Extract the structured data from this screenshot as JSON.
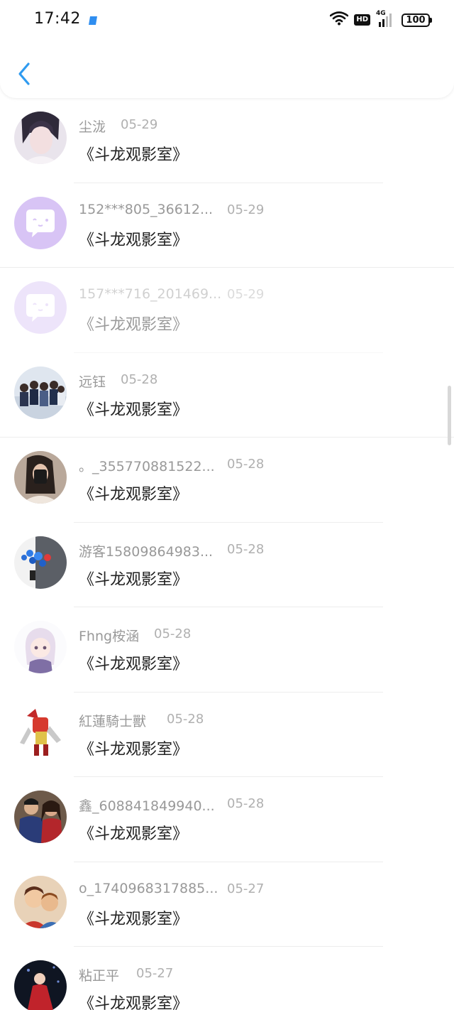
{
  "status_bar": {
    "time": "17:42",
    "hd": "HD",
    "network": "4G",
    "battery": "100"
  },
  "header": {
    "back_icon": "chevron-left-icon",
    "accent_color": "#2f9bf0"
  },
  "items": [
    {
      "username": "尘泷",
      "date": "05-29",
      "comment": "《斗龙观影室》",
      "avatar": "anime-portrait"
    },
    {
      "username": "152***805_36612...",
      "date": "05-29",
      "comment": "《斗龙观影室》",
      "avatar": "default-chat"
    },
    {
      "username": "157***716_201469...",
      "date": "05-29",
      "comment": "《斗龙观影室》",
      "avatar": "default-chat"
    },
    {
      "username": "远钰",
      "date": "05-28",
      "comment": "《斗龙观影室》",
      "avatar": "group-photo"
    },
    {
      "username": "。_355770881522...",
      "date": "05-28",
      "comment": "《斗龙观影室》",
      "avatar": "selfie"
    },
    {
      "username": "游客15809864983...",
      "date": "05-28",
      "comment": "《斗龙观影室》",
      "avatar": "balloons"
    },
    {
      "username": "Fhng桉涵",
      "date": "05-28",
      "comment": "《斗龙观影室》",
      "avatar": "anime-girl"
    },
    {
      "username": "紅蓮騎士獸",
      "date": "05-28",
      "comment": "《斗龙观影室》",
      "avatar": "armored-knight"
    },
    {
      "username": "鑫_608841849940...",
      "date": "05-28",
      "comment": "《斗龙观影室》",
      "avatar": "superheroes"
    },
    {
      "username": "o_1740968317885...",
      "date": "05-27",
      "comment": "《斗龙观影室》",
      "avatar": "cartoon-kids"
    },
    {
      "username": "粘正平",
      "date": "05-27",
      "comment": "《斗龙观影室》",
      "avatar": "red-dress"
    }
  ]
}
